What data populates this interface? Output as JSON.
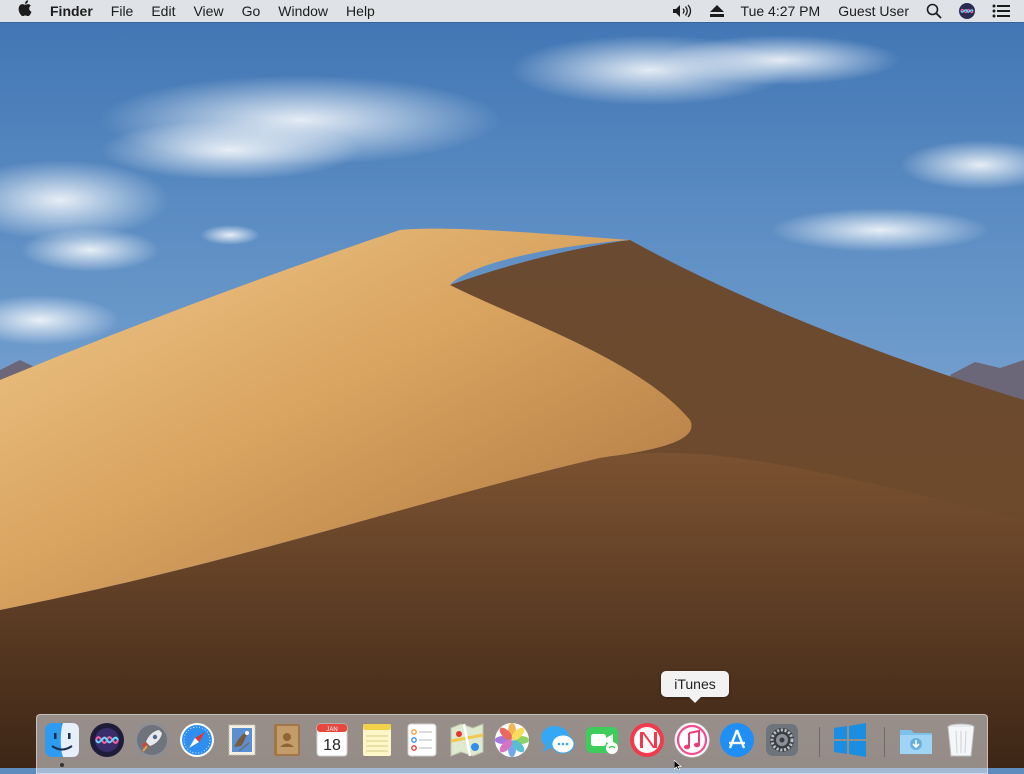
{
  "menubar": {
    "apple_icon": "apple-logo-icon",
    "app_name": "Finder",
    "menus": [
      "File",
      "Edit",
      "View",
      "Go",
      "Window",
      "Help"
    ],
    "status": {
      "volume_icon": "speaker-volume-icon",
      "eject_icon": "eject-icon",
      "clock": "Tue 4:27 PM",
      "user": "Guest User",
      "spotlight_icon": "magnifier-icon",
      "siri_icon": "siri-icon",
      "notification_icon": "notification-list-icon"
    }
  },
  "tooltip": {
    "text": "iTunes"
  },
  "dock": {
    "apps": [
      {
        "name": "Finder",
        "icon": "finder-icon"
      },
      {
        "name": "Siri",
        "icon": "siri-icon"
      },
      {
        "name": "Launchpad",
        "icon": "rocket-icon"
      },
      {
        "name": "Safari",
        "icon": "compass-icon"
      },
      {
        "name": "Mail",
        "icon": "eagle-stamp-icon"
      },
      {
        "name": "Contacts",
        "icon": "address-book-icon"
      },
      {
        "name": "Calendar",
        "icon": "calendar-icon",
        "month": "JAN",
        "day": "18"
      },
      {
        "name": "Notes",
        "icon": "notepad-icon"
      },
      {
        "name": "Reminders",
        "icon": "checklist-icon"
      },
      {
        "name": "Maps",
        "icon": "map-icon"
      },
      {
        "name": "Photos",
        "icon": "flower-icon"
      },
      {
        "name": "Messages",
        "icon": "speech-bubble-icon"
      },
      {
        "name": "FaceTime",
        "icon": "video-camera-icon"
      },
      {
        "name": "News",
        "icon": "news-icon"
      },
      {
        "name": "iTunes",
        "icon": "music-note-icon"
      },
      {
        "name": "App Store",
        "icon": "app-store-icon"
      },
      {
        "name": "System Preferences",
        "icon": "gear-icon"
      }
    ],
    "extras": [
      {
        "name": "Windows App",
        "icon": "windows-logo-icon"
      }
    ],
    "stack": {
      "name": "Downloads",
      "icon": "downloads-folder-icon"
    },
    "trash": {
      "name": "Trash",
      "icon": "trash-icon"
    }
  },
  "colors": {
    "sky_top": "#4d80bd",
    "sky_bottom": "#a8c4e0",
    "dune_light": "#e5b36d",
    "dune_dark": "#6e4a2c",
    "menubar_bg": "#ececec"
  }
}
